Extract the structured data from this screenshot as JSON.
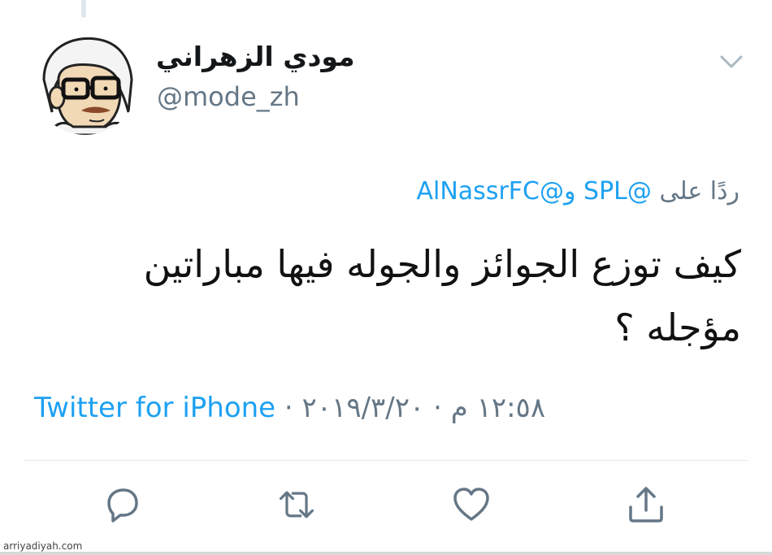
{
  "tweet": {
    "display_name": "مودي الزهراني",
    "handle": "@mode_zh",
    "reply_prefix": "ردًا على",
    "reply_mention_1": "@SPL",
    "reply_connector": "و",
    "reply_mention_2": "@AlNassrFC",
    "text_line_1": "كيف توزع الجوائز والجوله فيها مباراتين",
    "text_line_2": "مؤجله ؟",
    "source": "Twitter for iPhone",
    "separator": "·",
    "date": "٢٠١٩/٣/٢٠",
    "time": "١٢:٥٨ م"
  },
  "actions": [
    {
      "icon": "reply-icon"
    },
    {
      "icon": "retweet-icon"
    },
    {
      "icon": "like-icon"
    },
    {
      "icon": "share-icon"
    }
  ],
  "watermark": "arriyadiyah.com",
  "colors": {
    "accent": "#1da1f2",
    "secondary_text": "#657786",
    "divider": "#e1e8ed",
    "icon": "#657786"
  }
}
